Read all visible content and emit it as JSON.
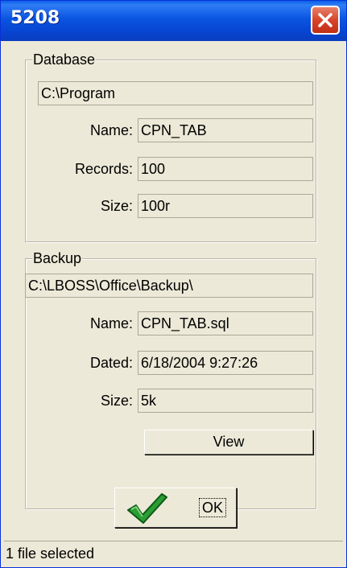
{
  "window": {
    "title": "5208"
  },
  "database": {
    "group_label": "Database",
    "path": "C:\\Program",
    "name_label": "Name:",
    "name": "CPN_TAB",
    "records_label": "Records:",
    "records": "100",
    "size_label": "Size:",
    "size": "100r"
  },
  "backup": {
    "group_label": "Backup",
    "path": "C:\\LBOSS\\Office\\Backup\\",
    "name_label": "Name:",
    "name": "CPN_TAB.sql",
    "dated_label": "Dated:",
    "dated": "6/18/2004 9:27:26",
    "size_label": "Size:",
    "size": "5k",
    "view_label": "View"
  },
  "ok_label": "OK",
  "status": "1 file selected",
  "icons": {
    "close": "close-icon",
    "ok": "checkmark-icon"
  },
  "colors": {
    "titlebar": "#0a54e2",
    "close": "#d8442a",
    "face": "#ece9d8",
    "checkmark": "#2a9d34"
  }
}
